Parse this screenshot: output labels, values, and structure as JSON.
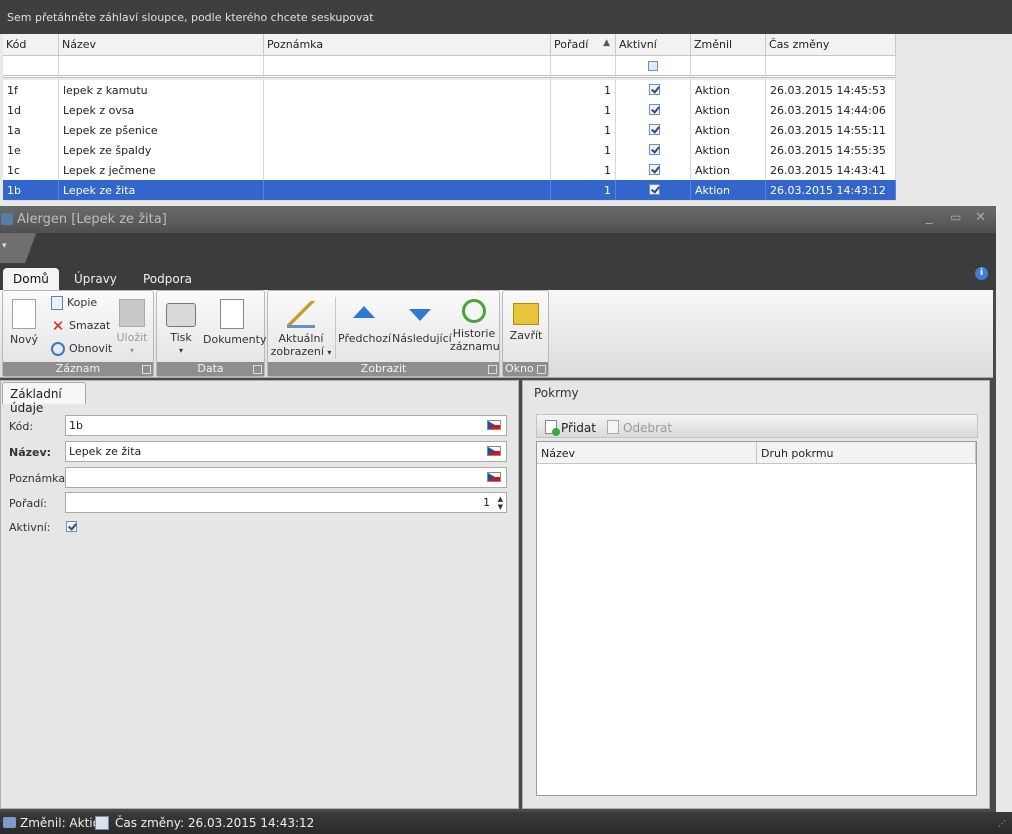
{
  "grid": {
    "group_panel_text": "Sem přetáhněte záhlaví sloupce, podle kterého chcete seskupovat",
    "columns": [
      "Kód",
      "Název",
      "Poznámka",
      "Pořadí",
      "Aktivní",
      "Změnil",
      "Čas změny"
    ],
    "sort_indicator": "▲",
    "rows": [
      {
        "kod": "1f",
        "nazev": "lepek z kamutu",
        "poznamka": "",
        "poradi": "1",
        "zmenil": "Aktion",
        "cas": "26.03.2015 14:45:53"
      },
      {
        "kod": "1d",
        "nazev": "Lepek z ovsa",
        "poznamka": "",
        "poradi": "1",
        "zmenil": "Aktion",
        "cas": "26.03.2015 14:44:06"
      },
      {
        "kod": "1a",
        "nazev": "Lepek ze pšenice",
        "poznamka": "",
        "poradi": "1",
        "zmenil": "Aktion",
        "cas": "26.03.2015 14:55:11"
      },
      {
        "kod": "1e",
        "nazev": "Lepek ze špaldy",
        "poznamka": "",
        "poradi": "1",
        "zmenil": "Aktion",
        "cas": "26.03.2015 14:55:35"
      },
      {
        "kod": "1c",
        "nazev": "Lepek z ječmene",
        "poznamka": "",
        "poradi": "1",
        "zmenil": "Aktion",
        "cas": "26.03.2015 14:43:41"
      },
      {
        "kod": "1b",
        "nazev": "Lepek ze žita",
        "poznamka": "",
        "poradi": "1",
        "zmenil": "Aktion",
        "cas": "26.03.2015 14:43:12"
      }
    ]
  },
  "window": {
    "title": "Alergen [Lepek ze žita]",
    "controls": {
      "minimize": "_",
      "maximize": "▭",
      "close": "✕"
    }
  },
  "ribbon": {
    "tabs": [
      "Domů",
      "Úpravy",
      "Podpora"
    ],
    "help": "i",
    "groups": {
      "zaznam": {
        "label": "Záznam",
        "novy": "Nový",
        "kopie": "Kopie",
        "smazat": "Smazat",
        "obnovit": "Obnovit",
        "ulozit": "Uložit"
      },
      "data": {
        "label": "Data",
        "tisk": "Tisk",
        "dokumenty": "Dokumenty"
      },
      "zobrazit": {
        "label": "Zobrazit",
        "aktualni_1": "Aktuální",
        "aktualni_2": "zobrazení",
        "predchozi": "Předchozí",
        "nasledujici": "Následující",
        "historie_1": "Historie",
        "historie_2": "záznamu"
      },
      "okno": {
        "label": "Okno",
        "zavrit": "Zavřít"
      }
    }
  },
  "form": {
    "tab": "Základní údaje",
    "labels": {
      "kod": "Kód:",
      "nazev": "Název:",
      "poznamka": "Poznámka:",
      "poradi": "Pořadí:",
      "aktivni": "Aktivní:"
    },
    "values": {
      "kod": "1b",
      "nazev": "Lepek ze žita",
      "poznamka": "",
      "poradi": "1"
    }
  },
  "pokrmy": {
    "title": "Pokrmy",
    "add": "Přidat",
    "remove": "Odebrat",
    "columns": [
      "Název",
      "Druh pokrmu"
    ]
  },
  "status": {
    "zmenil": "Změnil: Aktion",
    "cas": "Čas změny: 26.03.2015 14:43:12"
  }
}
